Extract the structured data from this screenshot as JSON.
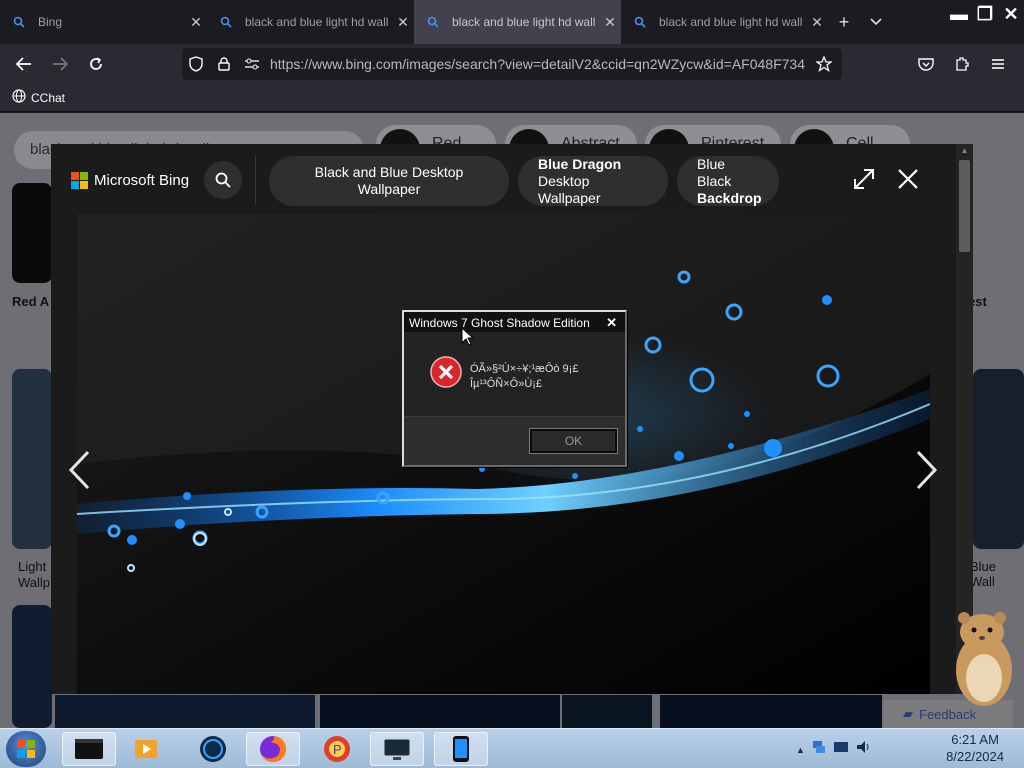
{
  "browser": {
    "tabs": [
      {
        "title": "Bing",
        "active": false
      },
      {
        "title": "black and blue light hd wall",
        "active": false
      },
      {
        "title": "black and blue light hd wall",
        "active": true
      },
      {
        "title": "black and blue light hd wall",
        "active": false
      }
    ],
    "url": "https://www.bing.com/images/search?view=detailV2&ccid=qn2WZycw&id=AF048F734",
    "bookmark": "CChat"
  },
  "page_bg": {
    "search_text": "black and blue light hd wall",
    "chips": [
      "Red",
      "Abstract",
      "Pinterest",
      "Cell"
    ],
    "labels": [
      "Red A",
      "Light Wallp",
      "est",
      "Blue Wall"
    ]
  },
  "viewer": {
    "brand": "Microsoft Bing",
    "related": [
      {
        "line1": "Black and Blue Desktop Wallpaper",
        "line2": "",
        "bold": ""
      },
      {
        "line1": "",
        "line2": "Desktop Wallpaper",
        "bold": "Blue Dragon"
      },
      {
        "line1": "Blue Black",
        "line2": "",
        "bold": "Backdrop"
      }
    ]
  },
  "dialog": {
    "title": "Windows 7 Ghost Shadow Edition",
    "message_line1": "ÓÃ»§²Ù×÷¥;¹æÔò 9¡£",
    "message_line2": "Îµ¹³ÔÑ×Ô»Ù¡£",
    "ok_label": "OK"
  },
  "feedback_label": "Feedback",
  "clock": {
    "time": "6:21 AM",
    "date": "8/22/2024"
  },
  "colors": {
    "accent": "#1e90ff",
    "error_red": "#d9262b"
  }
}
